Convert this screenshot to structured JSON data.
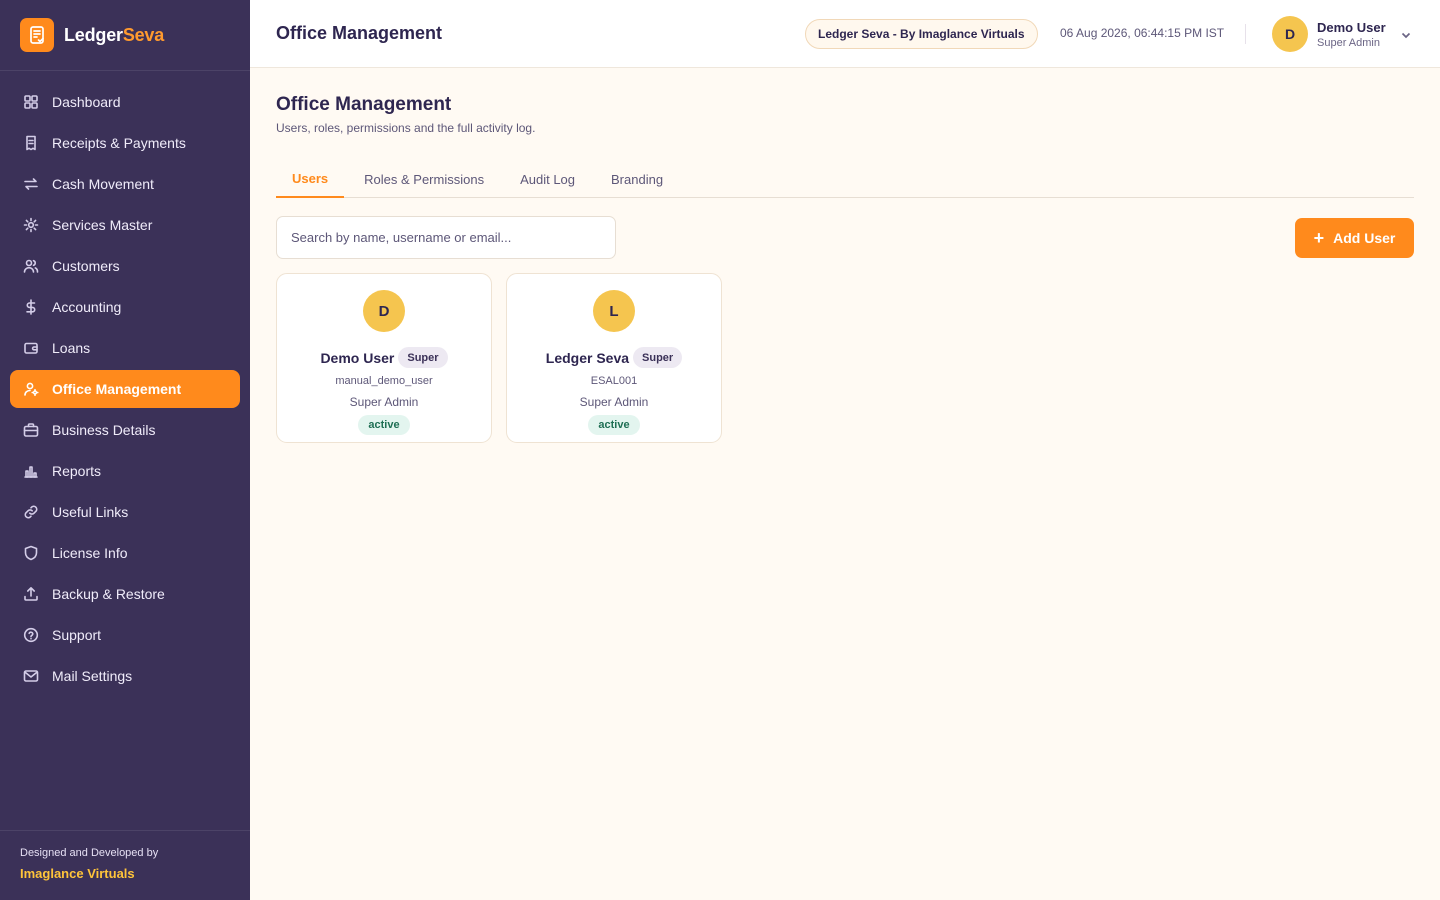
{
  "brand": {
    "name_part1": "Ledger",
    "name_part2": "Seva",
    "logo_icon": "ledger-book-icon",
    "accent": "#ff8a1c"
  },
  "sidebar": {
    "items": [
      {
        "label": "Dashboard",
        "icon": "dashboard-icon",
        "active": false
      },
      {
        "label": "Receipts & Payments",
        "icon": "receipt-icon",
        "active": false
      },
      {
        "label": "Cash Movement",
        "icon": "transfer-arrows-icon",
        "active": false
      },
      {
        "label": "Services Master",
        "icon": "gear-icon",
        "active": false
      },
      {
        "label": "Customers",
        "icon": "users-icon",
        "active": false
      },
      {
        "label": "Accounting",
        "icon": "dollar-icon",
        "active": false
      },
      {
        "label": "Loans",
        "icon": "wallet-icon",
        "active": false
      },
      {
        "label": "Office Management",
        "icon": "user-cog-icon",
        "active": true
      },
      {
        "label": "Business Details",
        "icon": "briefcase-icon",
        "active": false
      },
      {
        "label": "Reports",
        "icon": "bar-chart-icon",
        "active": false
      },
      {
        "label": "Useful Links",
        "icon": "link-icon",
        "active": false
      },
      {
        "label": "License Info",
        "icon": "shield-icon",
        "active": false
      },
      {
        "label": "Backup & Restore",
        "icon": "upload-icon",
        "active": false
      },
      {
        "label": "Support",
        "icon": "help-circle-icon",
        "active": false
      },
      {
        "label": "Mail Settings",
        "icon": "mail-icon",
        "active": false
      }
    ],
    "footer": {
      "line1": "Designed and Developed by",
      "line2": "Imaglance Virtuals"
    }
  },
  "header": {
    "title": "Office Management",
    "org_badge": "Ledger Seva - By Imaglance Virtuals",
    "datetime": "06 Aug 2026, 06:44:15 PM IST",
    "user": {
      "initial": "D",
      "name": "Demo User",
      "role": "Super Admin"
    }
  },
  "main": {
    "title": "Office Management",
    "subtitle": "Users, roles, permissions and the full activity log.",
    "tabs": [
      {
        "label": "Users",
        "active": true
      },
      {
        "label": "Roles & Permissions",
        "active": false
      },
      {
        "label": "Audit Log",
        "active": false
      },
      {
        "label": "Branding",
        "active": false
      }
    ],
    "search": {
      "placeholder": "Search by name, username or email...",
      "value": ""
    },
    "add_button": {
      "label": "Add User"
    },
    "users": [
      {
        "initial": "D",
        "name": "Demo User",
        "badge": "Super",
        "username": "manual_demo_user",
        "role": "Super Admin",
        "status": "active"
      },
      {
        "initial": "L",
        "name": "Ledger Seva",
        "badge": "Super",
        "username": "ESAL001",
        "role": "Super Admin",
        "status": "active"
      }
    ]
  }
}
